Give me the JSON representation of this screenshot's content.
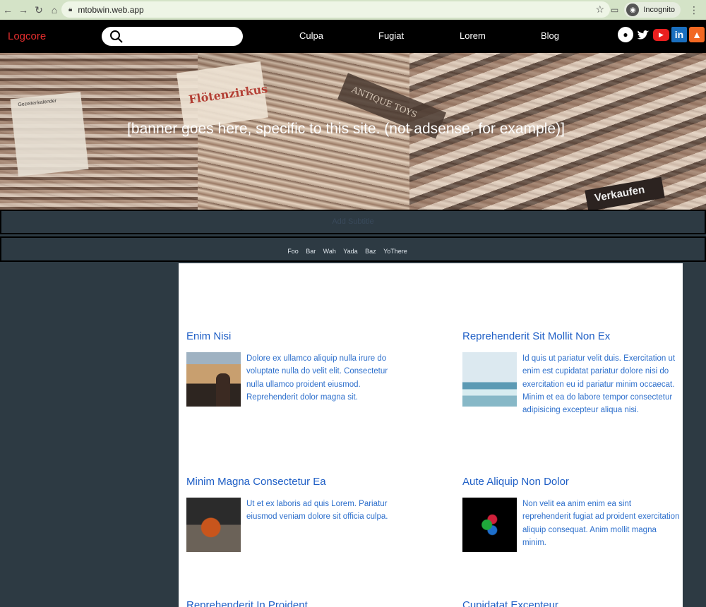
{
  "browser": {
    "url": "mtobwin.web.app",
    "incognito_label": "Incognito"
  },
  "header": {
    "logo": "Logcore",
    "search": {
      "placeholder": ""
    },
    "menu": [
      "Culpa",
      "Fugiat",
      "Lorem",
      "Blog"
    ],
    "socials": [
      "github-icon",
      "twitter-icon",
      "youtube-icon",
      "linkedin-icon",
      "fire-icon"
    ]
  },
  "banner": {
    "text": "[banner goes here, specific to this site. (not adsense, for example)]",
    "decor": {
      "book1": "Flötenzirkus",
      "book2": "ANTIQUE TOYS",
      "book3": "Gezeitenkalender",
      "spine": "Verkaufen"
    }
  },
  "subnav": {
    "bar1_text": "Add Subtitle",
    "links": [
      "Foo",
      "Bar",
      "Wah",
      "Yada",
      "Baz",
      "YoThere"
    ]
  },
  "cards": [
    {
      "title": "Enim Nisi",
      "text": "Dolore ex ullamco aliquip nulla irure do voluptate nulla do velit elit. Consectetur nulla ullamco proident eiusmod. Reprehenderit dolor magna sit."
    },
    {
      "title": "Reprehenderit Sit Mollit Non Ex",
      "text": "Id quis ut pariatur velit duis. Exercitation ut enim est cupidatat pariatur dolore nisi do exercitation eu id pariatur minim occaecat. Minim et ea do labore tempor consectetur adipisicing excepteur aliqua nisi."
    },
    {
      "title": "Minim Magna Consectetur Ea",
      "text": "Ut et ex laboris ad quis Lorem. Pariatur eiusmod veniam dolore sit officia culpa."
    },
    {
      "title": "Aute Aliquip Non Dolor",
      "text": "Non velit ea anim enim ea sint reprehenderit fugiat ad proident exercitation aliquip consequat. Anim mollit magna minim."
    },
    {
      "title": "Reprehenderit In Proident",
      "text": ""
    },
    {
      "title": "Cupidatat Excepteur",
      "text": ""
    }
  ]
}
